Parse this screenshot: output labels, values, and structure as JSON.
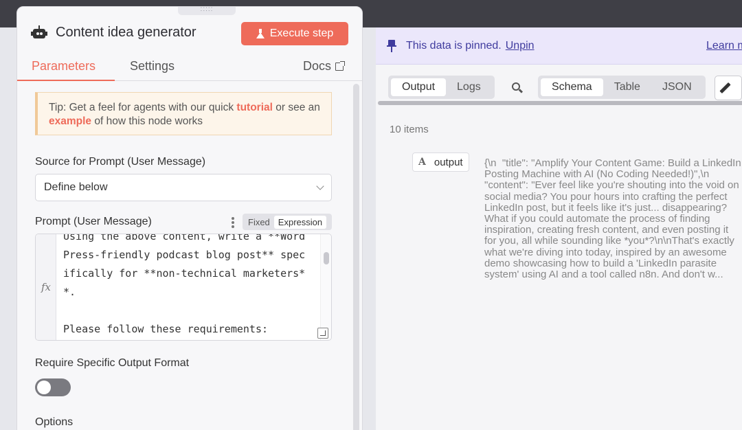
{
  "node": {
    "title": "Content idea generator",
    "execute_label": "Execute step",
    "drag_handle": ":::::",
    "tabs": {
      "parameters": "Parameters",
      "settings": "Settings",
      "docs": "Docs"
    },
    "tip": {
      "prefix": "Tip: Get a feel for agents with our quick ",
      "link1": "tutorial",
      "mid": " or see an ",
      "link2": "example",
      "suffix": " of how this node works"
    },
    "source_label": "Source for Prompt (User Message)",
    "source_value": "Define below",
    "prompt_label": "Prompt (User Message)",
    "mode": {
      "fixed": "Fixed",
      "expression": "Expression"
    },
    "fx": "fx",
    "prompt_code": "Using the above content, write a **Word\nPress-friendly podcast blog post** spec\nifically for **non-technical marketers*\n*.\n\nPlease follow these requirements:",
    "output_format_label": "Require Specific Output Format",
    "options_label": "Options"
  },
  "output": {
    "pinned_text": "This data is pinned.",
    "unpin": "Unpin",
    "learn_more": "Learn more",
    "tabs": {
      "output": "Output",
      "logs": "Logs"
    },
    "views": {
      "schema": "Schema",
      "table": "Table",
      "json": "JSON"
    },
    "items_count": "10 items",
    "field_type": "A",
    "field_name": "output",
    "field_value": "{\\n  \"title\": \"Amplify Your Content Game: Build a LinkedIn Posting Machine with AI (No Coding Needed!)\",\\n  \"content\": \"Ever feel like you're shouting into the void on social media? You pour hours into crafting the perfect LinkedIn post, but it feels like it's just... disappearing? What if you could automate the process of finding inspiration, creating fresh content, and even posting it for you, all while sounding like *you*?\\n\\nThat's exactly what we're diving into today, inspired by an awesome demo showcasing how to build a 'LinkedIn parasite system' using AI and a tool called n8n. And don't w..."
  },
  "colors": {
    "accent": "#ee6b5a",
    "pin_bg": "#ebe7fb",
    "pin_text": "#3f3b9e"
  }
}
